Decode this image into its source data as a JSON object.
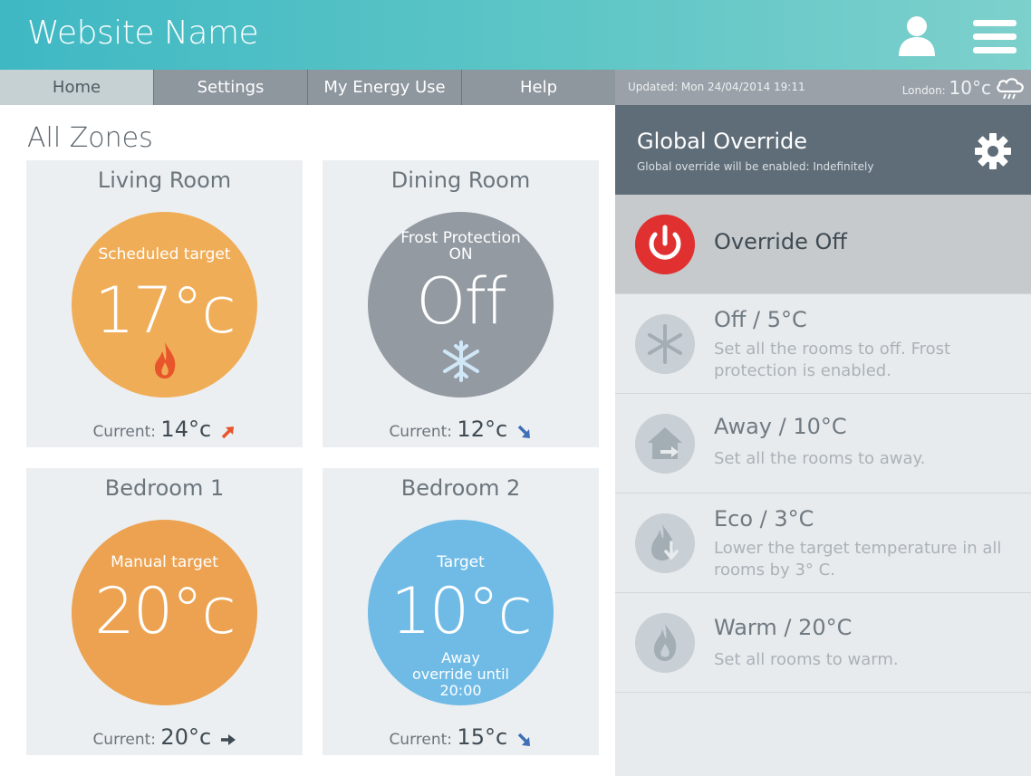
{
  "header": {
    "site_name": "Website Name"
  },
  "nav": {
    "tabs": [
      "Home",
      "Settings",
      "My Energy Use",
      "Help"
    ],
    "active": "Home"
  },
  "status": {
    "updated": "Updated: Mon 24/04/2014   19:11",
    "city": "London:",
    "temp": "10°c"
  },
  "page_title": "All Zones",
  "zones": [
    {
      "name": "Living Room",
      "label": "Scheduled target",
      "value": "17°c",
      "sub": "",
      "current_label": "Current:",
      "current": "14°c",
      "trend": "up",
      "color": "#f0ad57"
    },
    {
      "name": "Dining Room",
      "label": "Frost Protection ON",
      "value": "Off",
      "sub": "",
      "current_label": "Current:",
      "current": "12°c",
      "trend": "down",
      "color": "#939aa2"
    },
    {
      "name": "Bedroom 1",
      "label": "Manual target",
      "value": "20°c",
      "sub": "",
      "current_label": "Current:",
      "current": "20°c",
      "trend": "right",
      "color": "#eca250"
    },
    {
      "name": "Bedroom 2",
      "label": "Target",
      "value": "10°c",
      "sub": "Away override until 20:00",
      "current_label": "Current:",
      "current": "15°c",
      "trend": "down",
      "color": "#6fbbe6"
    }
  ],
  "global_override": {
    "title": "Global Override",
    "subtitle": "Global override will be enabled: Indefinitely",
    "options": [
      {
        "title": "Override Off",
        "desc": "",
        "icon": "power-icon"
      },
      {
        "title": "Off / 5°C",
        "desc": "Set all the rooms to off. Frost protection is enabled.",
        "icon": "snowflake-icon"
      },
      {
        "title": "Away / 10°C",
        "desc": "Set all the rooms to away.",
        "icon": "away-house-icon"
      },
      {
        "title": "Eco / 3°C",
        "desc": "Lower the target temperature in all rooms by 3° C.",
        "icon": "eco-flame-icon"
      },
      {
        "title": "Warm / 20°C",
        "desc": "Set all rooms to warm.",
        "icon": "flame-icon"
      }
    ]
  },
  "colors": {
    "header": "#3fb8c4",
    "flame": "#e8552a",
    "trend_up": "#e8552a",
    "trend_down": "#3f6fb5",
    "power": "#e03030"
  }
}
